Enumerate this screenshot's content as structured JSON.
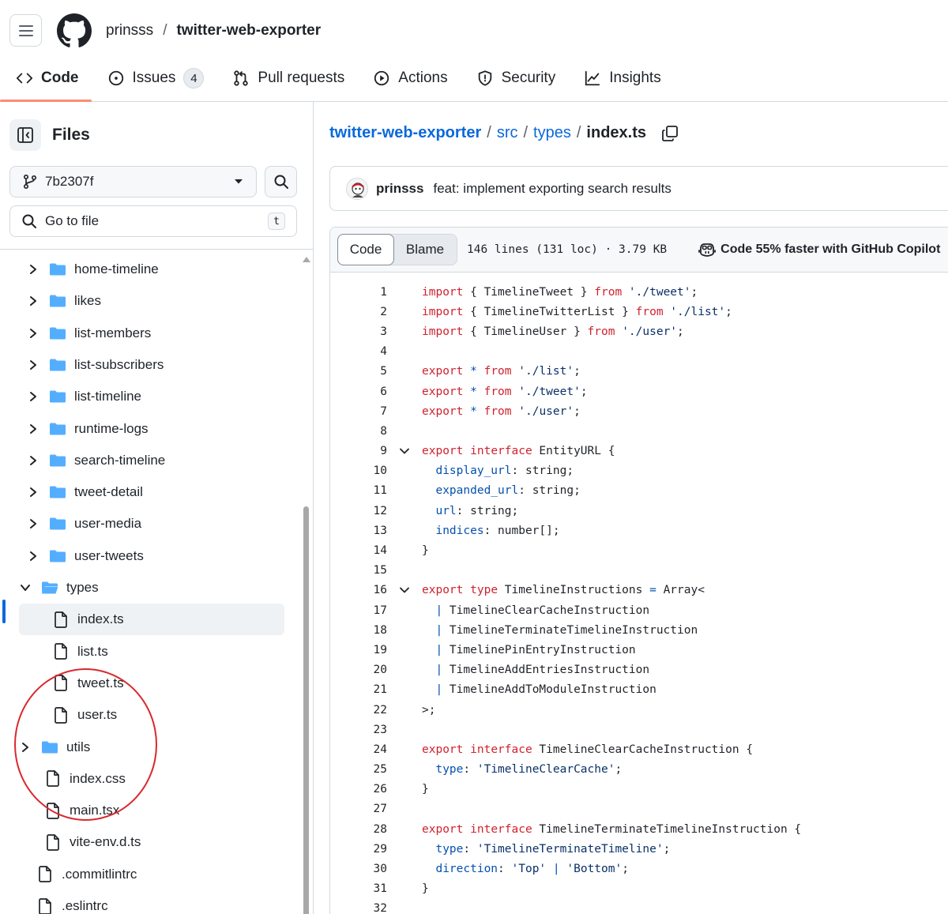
{
  "header": {
    "owner": "prinsss",
    "separator": "/",
    "repo": "twitter-web-exporter"
  },
  "nav": {
    "tabs": [
      {
        "label": "Code",
        "icon": "code-icon",
        "active": true
      },
      {
        "label": "Issues",
        "icon": "issue-opened-icon",
        "counter": "4"
      },
      {
        "label": "Pull requests",
        "icon": "git-pull-request-icon"
      },
      {
        "label": "Actions",
        "icon": "play-icon"
      },
      {
        "label": "Security",
        "icon": "shield-icon"
      },
      {
        "label": "Insights",
        "icon": "graph-icon"
      }
    ]
  },
  "sidebar": {
    "title": "Files",
    "branch": "7b2307f",
    "goto_placeholder": "Go to file",
    "goto_shortcut": "t",
    "tree": [
      {
        "label": "home-timeline",
        "kind": "folder",
        "expanded": false
      },
      {
        "label": "likes",
        "kind": "folder",
        "expanded": false
      },
      {
        "label": "list-members",
        "kind": "folder",
        "expanded": false
      },
      {
        "label": "list-subscribers",
        "kind": "folder",
        "expanded": false
      },
      {
        "label": "list-timeline",
        "kind": "folder",
        "expanded": false
      },
      {
        "label": "runtime-logs",
        "kind": "folder",
        "expanded": false
      },
      {
        "label": "search-timeline",
        "kind": "folder",
        "expanded": false
      },
      {
        "label": "tweet-detail",
        "kind": "folder",
        "expanded": false
      },
      {
        "label": "user-media",
        "kind": "folder",
        "expanded": false
      },
      {
        "label": "user-tweets",
        "kind": "folder",
        "expanded": false
      },
      {
        "label": "types",
        "kind": "folder",
        "expanded": true
      },
      {
        "label": "index.ts",
        "kind": "file",
        "selected": true
      },
      {
        "label": "list.ts",
        "kind": "file"
      },
      {
        "label": "tweet.ts",
        "kind": "file"
      },
      {
        "label": "user.ts",
        "kind": "file"
      },
      {
        "label": "utils",
        "kind": "folder",
        "expanded": false
      },
      {
        "label": "index.css",
        "kind": "file"
      },
      {
        "label": "main.tsx",
        "kind": "file"
      },
      {
        "label": "vite-env.d.ts",
        "kind": "file"
      },
      {
        "label": ".commitlintrc",
        "kind": "file"
      },
      {
        "label": ".eslintrc",
        "kind": "file"
      }
    ]
  },
  "main": {
    "breadcrumb": {
      "repo": "twitter-web-exporter",
      "sep": "/",
      "dir1": "src",
      "dir2": "types",
      "file": "index.ts"
    },
    "commit": {
      "author": "prinsss",
      "message": "feat: implement exporting search results"
    },
    "file_header": {
      "code_label": "Code",
      "blame_label": "Blame",
      "stats": "146 lines (131 loc) · 3.79 KB",
      "copilot": "Code 55% faster with GitHub Copilot"
    },
    "code_lines": [
      {
        "n": "1",
        "tokens": [
          [
            "k",
            "import"
          ],
          [
            "t",
            " { TimelineTweet } "
          ],
          [
            "k",
            "from"
          ],
          [
            "t",
            " "
          ],
          [
            "s",
            "'./tweet'"
          ],
          [
            "t",
            ";"
          ]
        ]
      },
      {
        "n": "2",
        "tokens": [
          [
            "k",
            "import"
          ],
          [
            "t",
            " { TimelineTwitterList } "
          ],
          [
            "k",
            "from"
          ],
          [
            "t",
            " "
          ],
          [
            "s",
            "'./list'"
          ],
          [
            "t",
            ";"
          ]
        ]
      },
      {
        "n": "3",
        "tokens": [
          [
            "k",
            "import"
          ],
          [
            "t",
            " { TimelineUser } "
          ],
          [
            "k",
            "from"
          ],
          [
            "t",
            " "
          ],
          [
            "s",
            "'./user'"
          ],
          [
            "t",
            ";"
          ]
        ]
      },
      {
        "n": "4",
        "tokens": []
      },
      {
        "n": "5",
        "tokens": [
          [
            "k",
            "export"
          ],
          [
            "t",
            " "
          ],
          [
            "p",
            "*"
          ],
          [
            "t",
            " "
          ],
          [
            "k",
            "from"
          ],
          [
            "t",
            " "
          ],
          [
            "s",
            "'./list'"
          ],
          [
            "t",
            ";"
          ]
        ]
      },
      {
        "n": "6",
        "tokens": [
          [
            "k",
            "export"
          ],
          [
            "t",
            " "
          ],
          [
            "p",
            "*"
          ],
          [
            "t",
            " "
          ],
          [
            "k",
            "from"
          ],
          [
            "t",
            " "
          ],
          [
            "s",
            "'./tweet'"
          ],
          [
            "t",
            ";"
          ]
        ]
      },
      {
        "n": "7",
        "tokens": [
          [
            "k",
            "export"
          ],
          [
            "t",
            " "
          ],
          [
            "p",
            "*"
          ],
          [
            "t",
            " "
          ],
          [
            "k",
            "from"
          ],
          [
            "t",
            " "
          ],
          [
            "s",
            "'./user'"
          ],
          [
            "t",
            ";"
          ]
        ]
      },
      {
        "n": "8",
        "tokens": []
      },
      {
        "n": "9",
        "fold": true,
        "tokens": [
          [
            "k",
            "export"
          ],
          [
            "t",
            " "
          ],
          [
            "k",
            "interface"
          ],
          [
            "t",
            " EntityURL {"
          ]
        ]
      },
      {
        "n": "10",
        "tokens": [
          [
            "t",
            "  "
          ],
          [
            "p",
            "display_url"
          ],
          [
            "t",
            ": string;"
          ]
        ]
      },
      {
        "n": "11",
        "tokens": [
          [
            "t",
            "  "
          ],
          [
            "p",
            "expanded_url"
          ],
          [
            "t",
            ": string;"
          ]
        ]
      },
      {
        "n": "12",
        "tokens": [
          [
            "t",
            "  "
          ],
          [
            "p",
            "url"
          ],
          [
            "t",
            ": string;"
          ]
        ]
      },
      {
        "n": "13",
        "tokens": [
          [
            "t",
            "  "
          ],
          [
            "p",
            "indices"
          ],
          [
            "t",
            ": number[];"
          ]
        ]
      },
      {
        "n": "14",
        "tokens": [
          [
            "t",
            "}"
          ]
        ]
      },
      {
        "n": "15",
        "tokens": []
      },
      {
        "n": "16",
        "fold": true,
        "tokens": [
          [
            "k",
            "export"
          ],
          [
            "t",
            " "
          ],
          [
            "k",
            "type"
          ],
          [
            "t",
            " TimelineInstructions "
          ],
          [
            "p",
            "="
          ],
          [
            "t",
            " Array<"
          ]
        ]
      },
      {
        "n": "17",
        "tokens": [
          [
            "t",
            "  "
          ],
          [
            "p",
            "|"
          ],
          [
            "t",
            " TimelineClearCacheInstruction"
          ]
        ]
      },
      {
        "n": "18",
        "tokens": [
          [
            "t",
            "  "
          ],
          [
            "p",
            "|"
          ],
          [
            "t",
            " TimelineTerminateTimelineInstruction"
          ]
        ]
      },
      {
        "n": "19",
        "tokens": [
          [
            "t",
            "  "
          ],
          [
            "p",
            "|"
          ],
          [
            "t",
            " TimelinePinEntryInstruction"
          ]
        ]
      },
      {
        "n": "20",
        "tokens": [
          [
            "t",
            "  "
          ],
          [
            "p",
            "|"
          ],
          [
            "t",
            " TimelineAddEntriesInstruction"
          ]
        ]
      },
      {
        "n": "21",
        "tokens": [
          [
            "t",
            "  "
          ],
          [
            "p",
            "|"
          ],
          [
            "t",
            " TimelineAddToModuleInstruction"
          ]
        ]
      },
      {
        "n": "22",
        "tokens": [
          [
            "t",
            ">;"
          ]
        ]
      },
      {
        "n": "23",
        "tokens": []
      },
      {
        "n": "24",
        "tokens": [
          [
            "k",
            "export"
          ],
          [
            "t",
            " "
          ],
          [
            "k",
            "interface"
          ],
          [
            "t",
            " TimelineClearCacheInstruction {"
          ]
        ]
      },
      {
        "n": "25",
        "tokens": [
          [
            "t",
            "  "
          ],
          [
            "p",
            "type"
          ],
          [
            "t",
            ": "
          ],
          [
            "s",
            "'TimelineClearCache'"
          ],
          [
            "t",
            ";"
          ]
        ]
      },
      {
        "n": "26",
        "tokens": [
          [
            "t",
            "}"
          ]
        ]
      },
      {
        "n": "27",
        "tokens": []
      },
      {
        "n": "28",
        "tokens": [
          [
            "k",
            "export"
          ],
          [
            "t",
            " "
          ],
          [
            "k",
            "interface"
          ],
          [
            "t",
            " TimelineTerminateTimelineInstruction {"
          ]
        ]
      },
      {
        "n": "29",
        "tokens": [
          [
            "t",
            "  "
          ],
          [
            "p",
            "type"
          ],
          [
            "t",
            ": "
          ],
          [
            "s",
            "'TimelineTerminateTimeline'"
          ],
          [
            "t",
            ";"
          ]
        ]
      },
      {
        "n": "30",
        "tokens": [
          [
            "t",
            "  "
          ],
          [
            "p",
            "direction"
          ],
          [
            "t",
            ": "
          ],
          [
            "s",
            "'Top'"
          ],
          [
            "t",
            " "
          ],
          [
            "p",
            "|"
          ],
          [
            "t",
            " "
          ],
          [
            "s",
            "'Bottom'"
          ],
          [
            "t",
            ";"
          ]
        ]
      },
      {
        "n": "31",
        "tokens": [
          [
            "t",
            "}"
          ]
        ]
      },
      {
        "n": "32",
        "tokens": []
      }
    ]
  },
  "colors": {
    "accent": "#0969da",
    "folder": "#54aeff",
    "keyword": "#cf222e",
    "string": "#0a3069",
    "property": "#0550ae",
    "annotation": "#d9282f",
    "tab_underline": "#fd8c73"
  }
}
